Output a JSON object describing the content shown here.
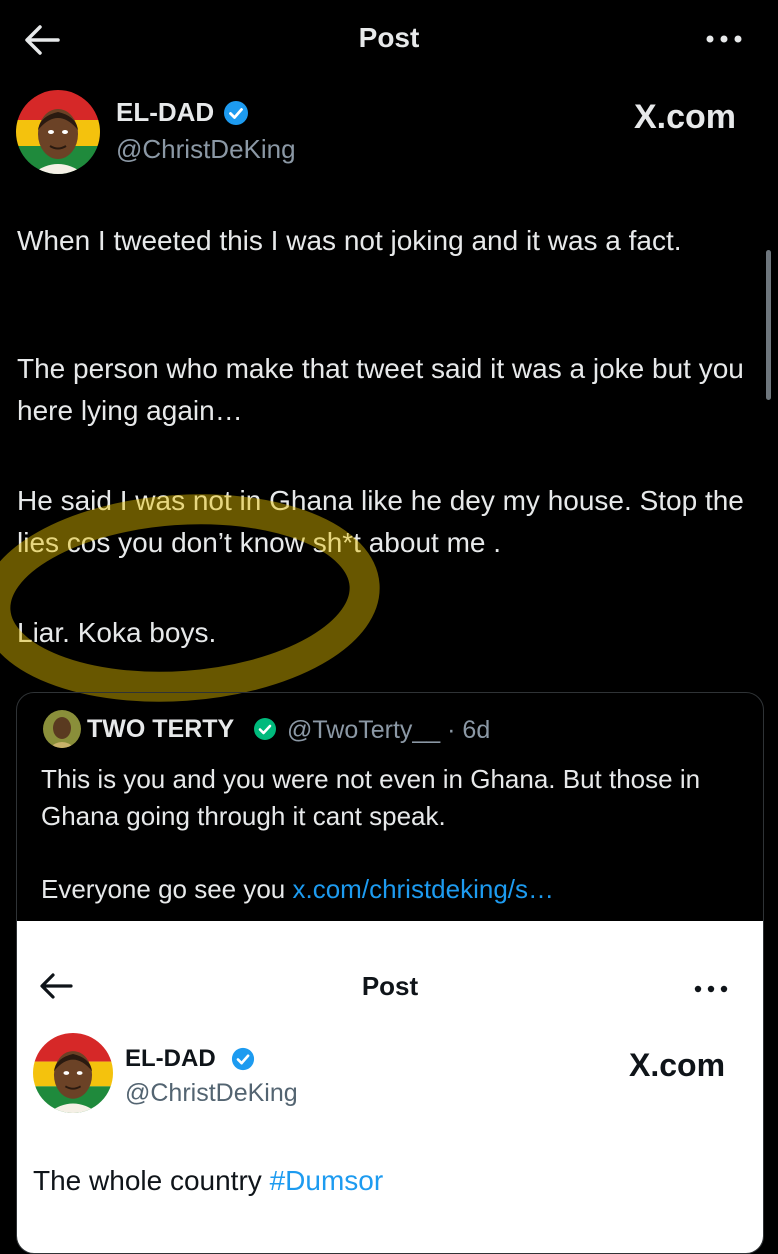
{
  "header": {
    "title": "Post",
    "back_icon": "arrow-left-icon",
    "more_icon": "more-horizontal-icon"
  },
  "author": {
    "name": "EL-DAD",
    "handle": "@ChristDeKing",
    "verified_icon": "verified-badge-icon",
    "source_label": "X.com"
  },
  "post": {
    "paragraphs": [
      "When I tweeted this I was not joking and it was a fact.",
      "The person who make that tweet said it was a joke but you here lying again…",
      "He said I was not in Ghana like he dey my house. Stop the lies cos you don’t know sh*t about me .",
      "Liar. Koka boys."
    ]
  },
  "quote": {
    "name": "TWO TERTY",
    "handle_time": "@TwoTerty__ · 6d",
    "text1": "This is you and you were not even in Ghana. But those in Ghana going through it cant speak.",
    "text2_prefix": "Everyone go see you ",
    "text2_link": "x.com/christdeking/s…",
    "embedded": {
      "title": "Post",
      "name": "EL-DAD",
      "handle": "@ChristDeKing",
      "source_label": "X.com",
      "text_prefix": "The whole country ",
      "hashtag": "#Dumsor"
    }
  },
  "colors": {
    "background": "#000000",
    "text_primary": "#e7e9ea",
    "text_secondary": "#8b98a5",
    "link": "#1d9bf0",
    "verified": "#1d9bf0",
    "marker": "#e6c200"
  }
}
